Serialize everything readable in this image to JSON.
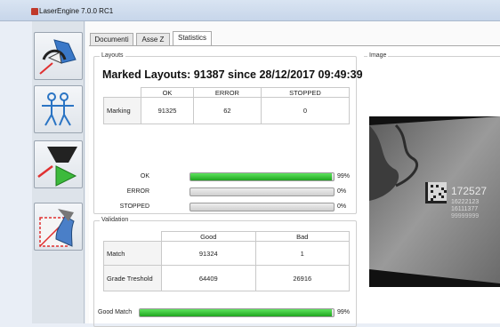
{
  "window": {
    "title": "LaserEngine 7.0.0 RC1"
  },
  "toolbar": {
    "buttons": [
      "marking-head",
      "people",
      "laser-start",
      "layout-editor"
    ]
  },
  "tabs": [
    "Documenti",
    "Asse Z",
    "Statistics"
  ],
  "layouts": {
    "legend": "Layouts",
    "title": "Marked Layouts: 91387 since 28/12/2017 09:49:39",
    "headers": [
      "OK",
      "ERROR",
      "STOPPED"
    ],
    "row_label": "Marking",
    "values": [
      "91325",
      "62",
      "0"
    ],
    "bars": [
      {
        "label": "OK",
        "fraction": 0.99,
        "pct": "99%"
      },
      {
        "label": "ERROR",
        "fraction": 0.0,
        "pct": "0%"
      },
      {
        "label": "STOPPED",
        "fraction": 0.0,
        "pct": "0%"
      }
    ]
  },
  "validation": {
    "legend": "Validation",
    "headers": [
      "Good",
      "Bad"
    ],
    "rows": [
      {
        "label": "Match",
        "good": "91324",
        "bad": "1"
      },
      {
        "label": "Grade Treshold",
        "good": "64409",
        "bad": "26916"
      }
    ],
    "good_match": {
      "label": "Good Match",
      "fraction": 0.99,
      "pct": "99%"
    }
  },
  "image_panel": {
    "legend": "Image",
    "code_lines": [
      "172527",
      "16222123",
      "16111377",
      "99999999"
    ]
  }
}
